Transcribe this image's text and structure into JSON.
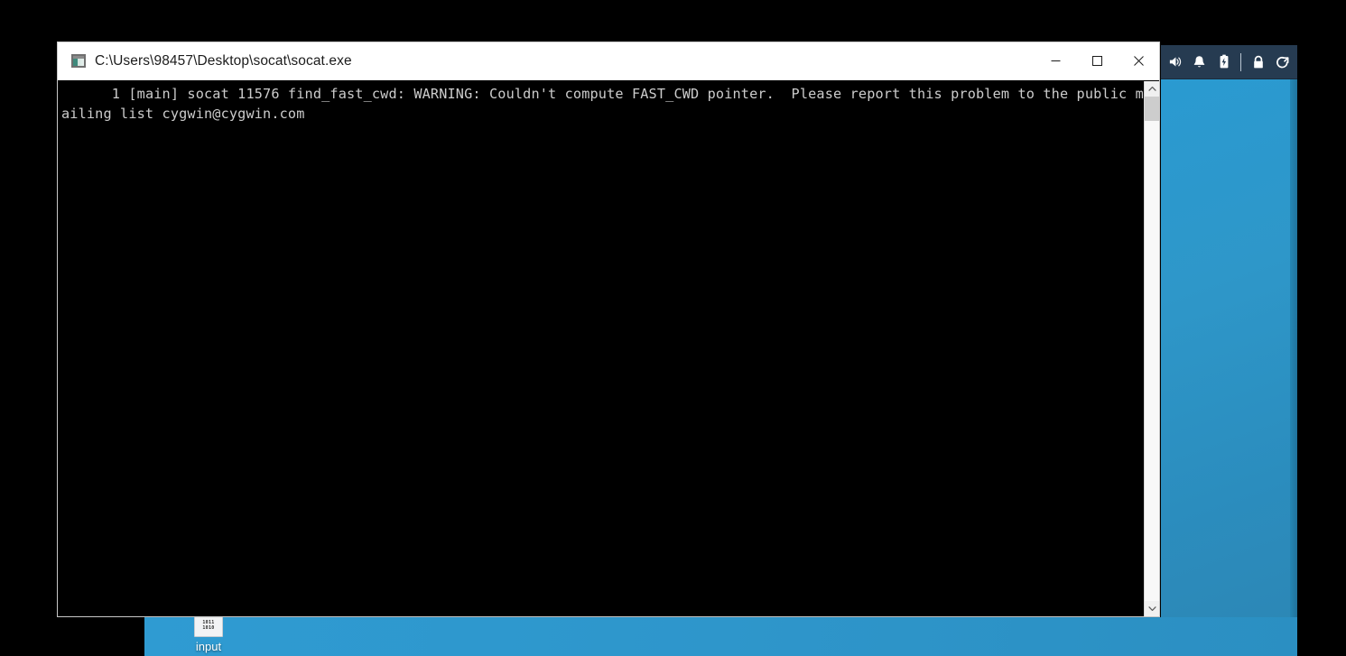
{
  "window": {
    "title": "C:\\Users\\98457\\Desktop\\socat\\socat.exe",
    "icon": "console-window-icon",
    "controls": {
      "minimize_label": "—",
      "maximize_label": "☐",
      "close_label": "✕"
    }
  },
  "console": {
    "text": "      1 [main] socat 11576 find_fast_cwd: WARNING: Couldn't compute FAST_CWD pointer.  Please report this problem to the public mailing list cygwin@cygwin.com",
    "foreground_color": "#cccccc",
    "background_color": "#000000"
  },
  "scrollbar": {
    "up_arrow": "chevron-up-icon",
    "down_arrow": "chevron-down-icon",
    "thumb_position_percent": 0
  },
  "taskbar": {
    "background_color": "#263b51",
    "tray_items": [
      {
        "name": "volume-icon",
        "label": "Volume"
      },
      {
        "name": "notification-bell-icon",
        "label": "Notifications"
      },
      {
        "name": "battery-icon",
        "label": "Battery"
      },
      {
        "name": "lock-icon",
        "label": "Lock"
      },
      {
        "name": "logout-icon",
        "label": "Log off"
      }
    ]
  },
  "desktop": {
    "background_color": "#2e96cb",
    "icons": [
      {
        "name": "input-file-icon",
        "label": "input",
        "bits_line1": "1011",
        "bits_line2": "1010"
      }
    ]
  }
}
